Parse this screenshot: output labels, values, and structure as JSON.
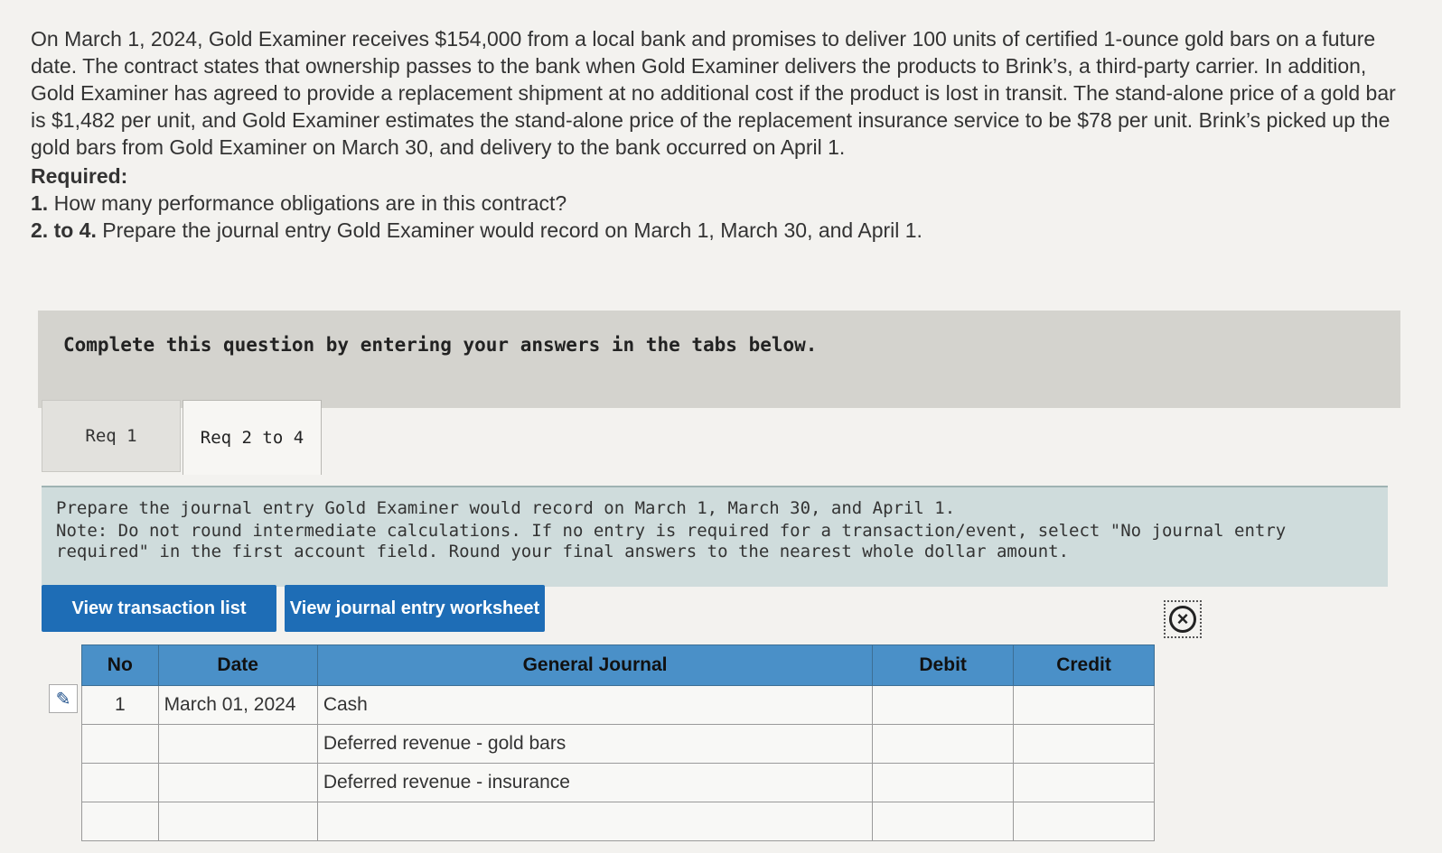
{
  "problem": {
    "paragraph": "On March 1, 2024, Gold Examiner receives $154,000 from a local bank and promises to deliver 100 units of certified 1-ounce gold bars on a future date. The contract states that ownership passes to the bank when Gold Examiner delivers the products to Brink’s, a third-party carrier. In addition, Gold Examiner has agreed to provide a replacement shipment at no additional cost if the product is lost in transit. The stand-alone price of a gold bar is $1,482 per unit, and Gold Examiner estimates the stand-alone price of the replacement insurance service to be $78 per unit. Brink’s picked up the gold bars from Gold Examiner on March 30, and delivery to the bank occurred on April 1.",
    "required_heading": "Required:",
    "req1_num": "1.",
    "req1_text": "How many performance obligations are in this contract?",
    "req2_num": "2. to 4.",
    "req2_text": "Prepare the journal entry Gold Examiner would record on March 1, March 30, and April 1."
  },
  "banner": {
    "text": "Complete this question by entering your answers in the tabs below."
  },
  "tabs": [
    {
      "label": "Req 1"
    },
    {
      "label": "Req 2 to 4"
    }
  ],
  "instructions": {
    "line1": "Prepare the journal entry Gold Examiner would record on March 1, March 30, and April 1.",
    "line2": "Note: Do not round intermediate calculations. If no entry is required for a transaction/event, select \"No journal entry required\" in the first account field. Round your final answers to the nearest whole dollar amount."
  },
  "buttons": {
    "transaction_list": "View transaction list",
    "journal_worksheet": "View journal entry worksheet"
  },
  "icons": {
    "close": "close-circle-icon",
    "edit": "pencil-icon"
  },
  "colors": {
    "button_blue": "#1e6db6",
    "header_blue": "#4a90c8",
    "instruction_bg": "#cfdcdc"
  },
  "table": {
    "headers": {
      "no": "No",
      "date": "Date",
      "journal": "General Journal",
      "debit": "Debit",
      "credit": "Credit"
    },
    "rows": [
      {
        "no": "1",
        "date": "March 01, 2024",
        "account": "Cash",
        "debit": "",
        "credit": ""
      },
      {
        "no": "",
        "date": "",
        "account": "Deferred revenue - gold bars",
        "debit": "",
        "credit": ""
      },
      {
        "no": "",
        "date": "",
        "account": "Deferred revenue - insurance",
        "debit": "",
        "credit": ""
      },
      {
        "no": "",
        "date": "",
        "account": "",
        "debit": "",
        "credit": ""
      }
    ]
  }
}
